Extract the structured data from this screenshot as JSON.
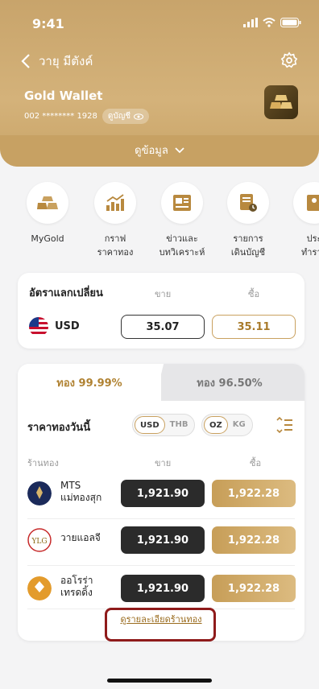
{
  "status": {
    "time": "9:41"
  },
  "nav": {
    "back_label": "วายุ มีตังค์"
  },
  "wallet": {
    "title": "Gold Wallet",
    "account": "002 ******** 1928",
    "view_label": "ดูบัญชี"
  },
  "more_label": "ดูข้อมูล",
  "menu": [
    {
      "label": "MyGold",
      "icon": "gold-bars-icon"
    },
    {
      "label": "กราฟ\nราคาทอง",
      "icon": "chart-icon"
    },
    {
      "label": "ข่าวและ\nบทวิเคราะห์",
      "icon": "news-icon"
    },
    {
      "label": "รายการ\nเดินบัญชี",
      "icon": "statement-icon"
    },
    {
      "label": "ประ\nทำราย",
      "icon": "history-icon"
    }
  ],
  "fx": {
    "title": "อัตราแลกเปลี่ยน",
    "sell_header": "ขาย",
    "buy_header": "ซื้อ",
    "currency": "USD",
    "sell": "35.07",
    "buy": "35.11"
  },
  "tabs": {
    "active": "ทอง 99.99%",
    "inactive": "ทอง 96.50%"
  },
  "prices": {
    "title": "ราคาทองวันนี้",
    "currency_toggle": [
      "USD",
      "THB"
    ],
    "unit_toggle": [
      "OZ",
      "KG"
    ],
    "shop_header": "ร้านทอง",
    "sell_header": "ขาย",
    "buy_header": "ซื้อ",
    "rows": [
      {
        "name": "MTS\nแม่ทองสุก",
        "sell": "1,921.90",
        "buy": "1,922.28"
      },
      {
        "name": "วายแอลจี",
        "sell": "1,921.90",
        "buy": "1,922.28"
      },
      {
        "name": "ออโรร่า\nเทรดดิ้ง",
        "sell": "1,921.90",
        "buy": "1,922.28"
      }
    ],
    "detail_link": "ดูรายละเอียดร้านทอง"
  },
  "colors": {
    "gold": "#c9a15f",
    "dark": "#2b2b2b",
    "highlight": "#8f1b1b"
  }
}
